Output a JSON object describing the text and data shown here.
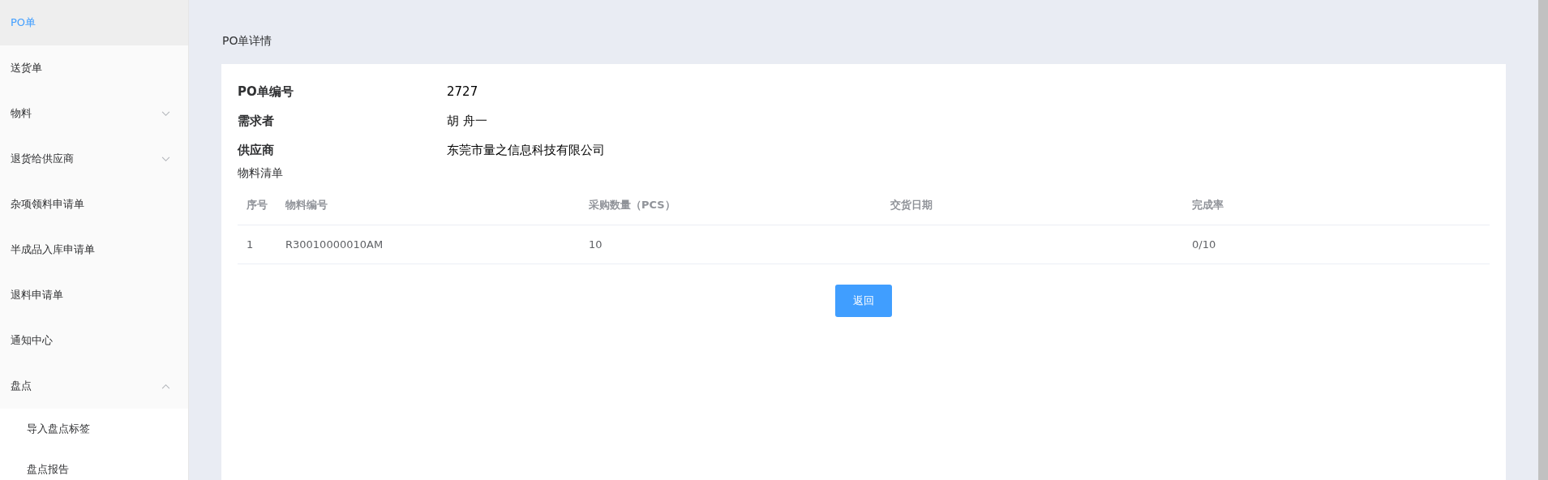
{
  "sidebar": {
    "items": [
      {
        "label": "PO单",
        "selected": true
      },
      {
        "label": "送货单",
        "selected": false
      },
      {
        "label": "物料",
        "selected": false,
        "expanded": false
      },
      {
        "label": "退货给供应商",
        "selected": false,
        "expanded": false
      },
      {
        "label": "杂项领料申请单",
        "selected": false
      },
      {
        "label": "半成品入库申请单",
        "selected": false
      },
      {
        "label": "退料申请单",
        "selected": false
      },
      {
        "label": "通知中心",
        "selected": false
      },
      {
        "label": "盘点",
        "selected": false,
        "expanded": true,
        "children": [
          {
            "label": "导入盘点标签",
            "selected": false
          },
          {
            "label": "盘点报告",
            "selected": false
          }
        ]
      }
    ]
  },
  "page_title": "PO单详情",
  "details": [
    {
      "label": "PO单编号",
      "value": "2727"
    },
    {
      "label": "需求者",
      "value": "胡 舟一"
    },
    {
      "label": "供应商",
      "value": "东莞市量之信息科技有限公司"
    }
  ],
  "materials": {
    "title": "物料清单",
    "columns": [
      "序号",
      "物料编号",
      "采购数量（PCS）",
      "交货日期",
      "完成率"
    ],
    "rows": [
      [
        "1",
        "R30010000010AM",
        "10",
        "",
        "0/10"
      ]
    ]
  },
  "back_button": "返回"
}
